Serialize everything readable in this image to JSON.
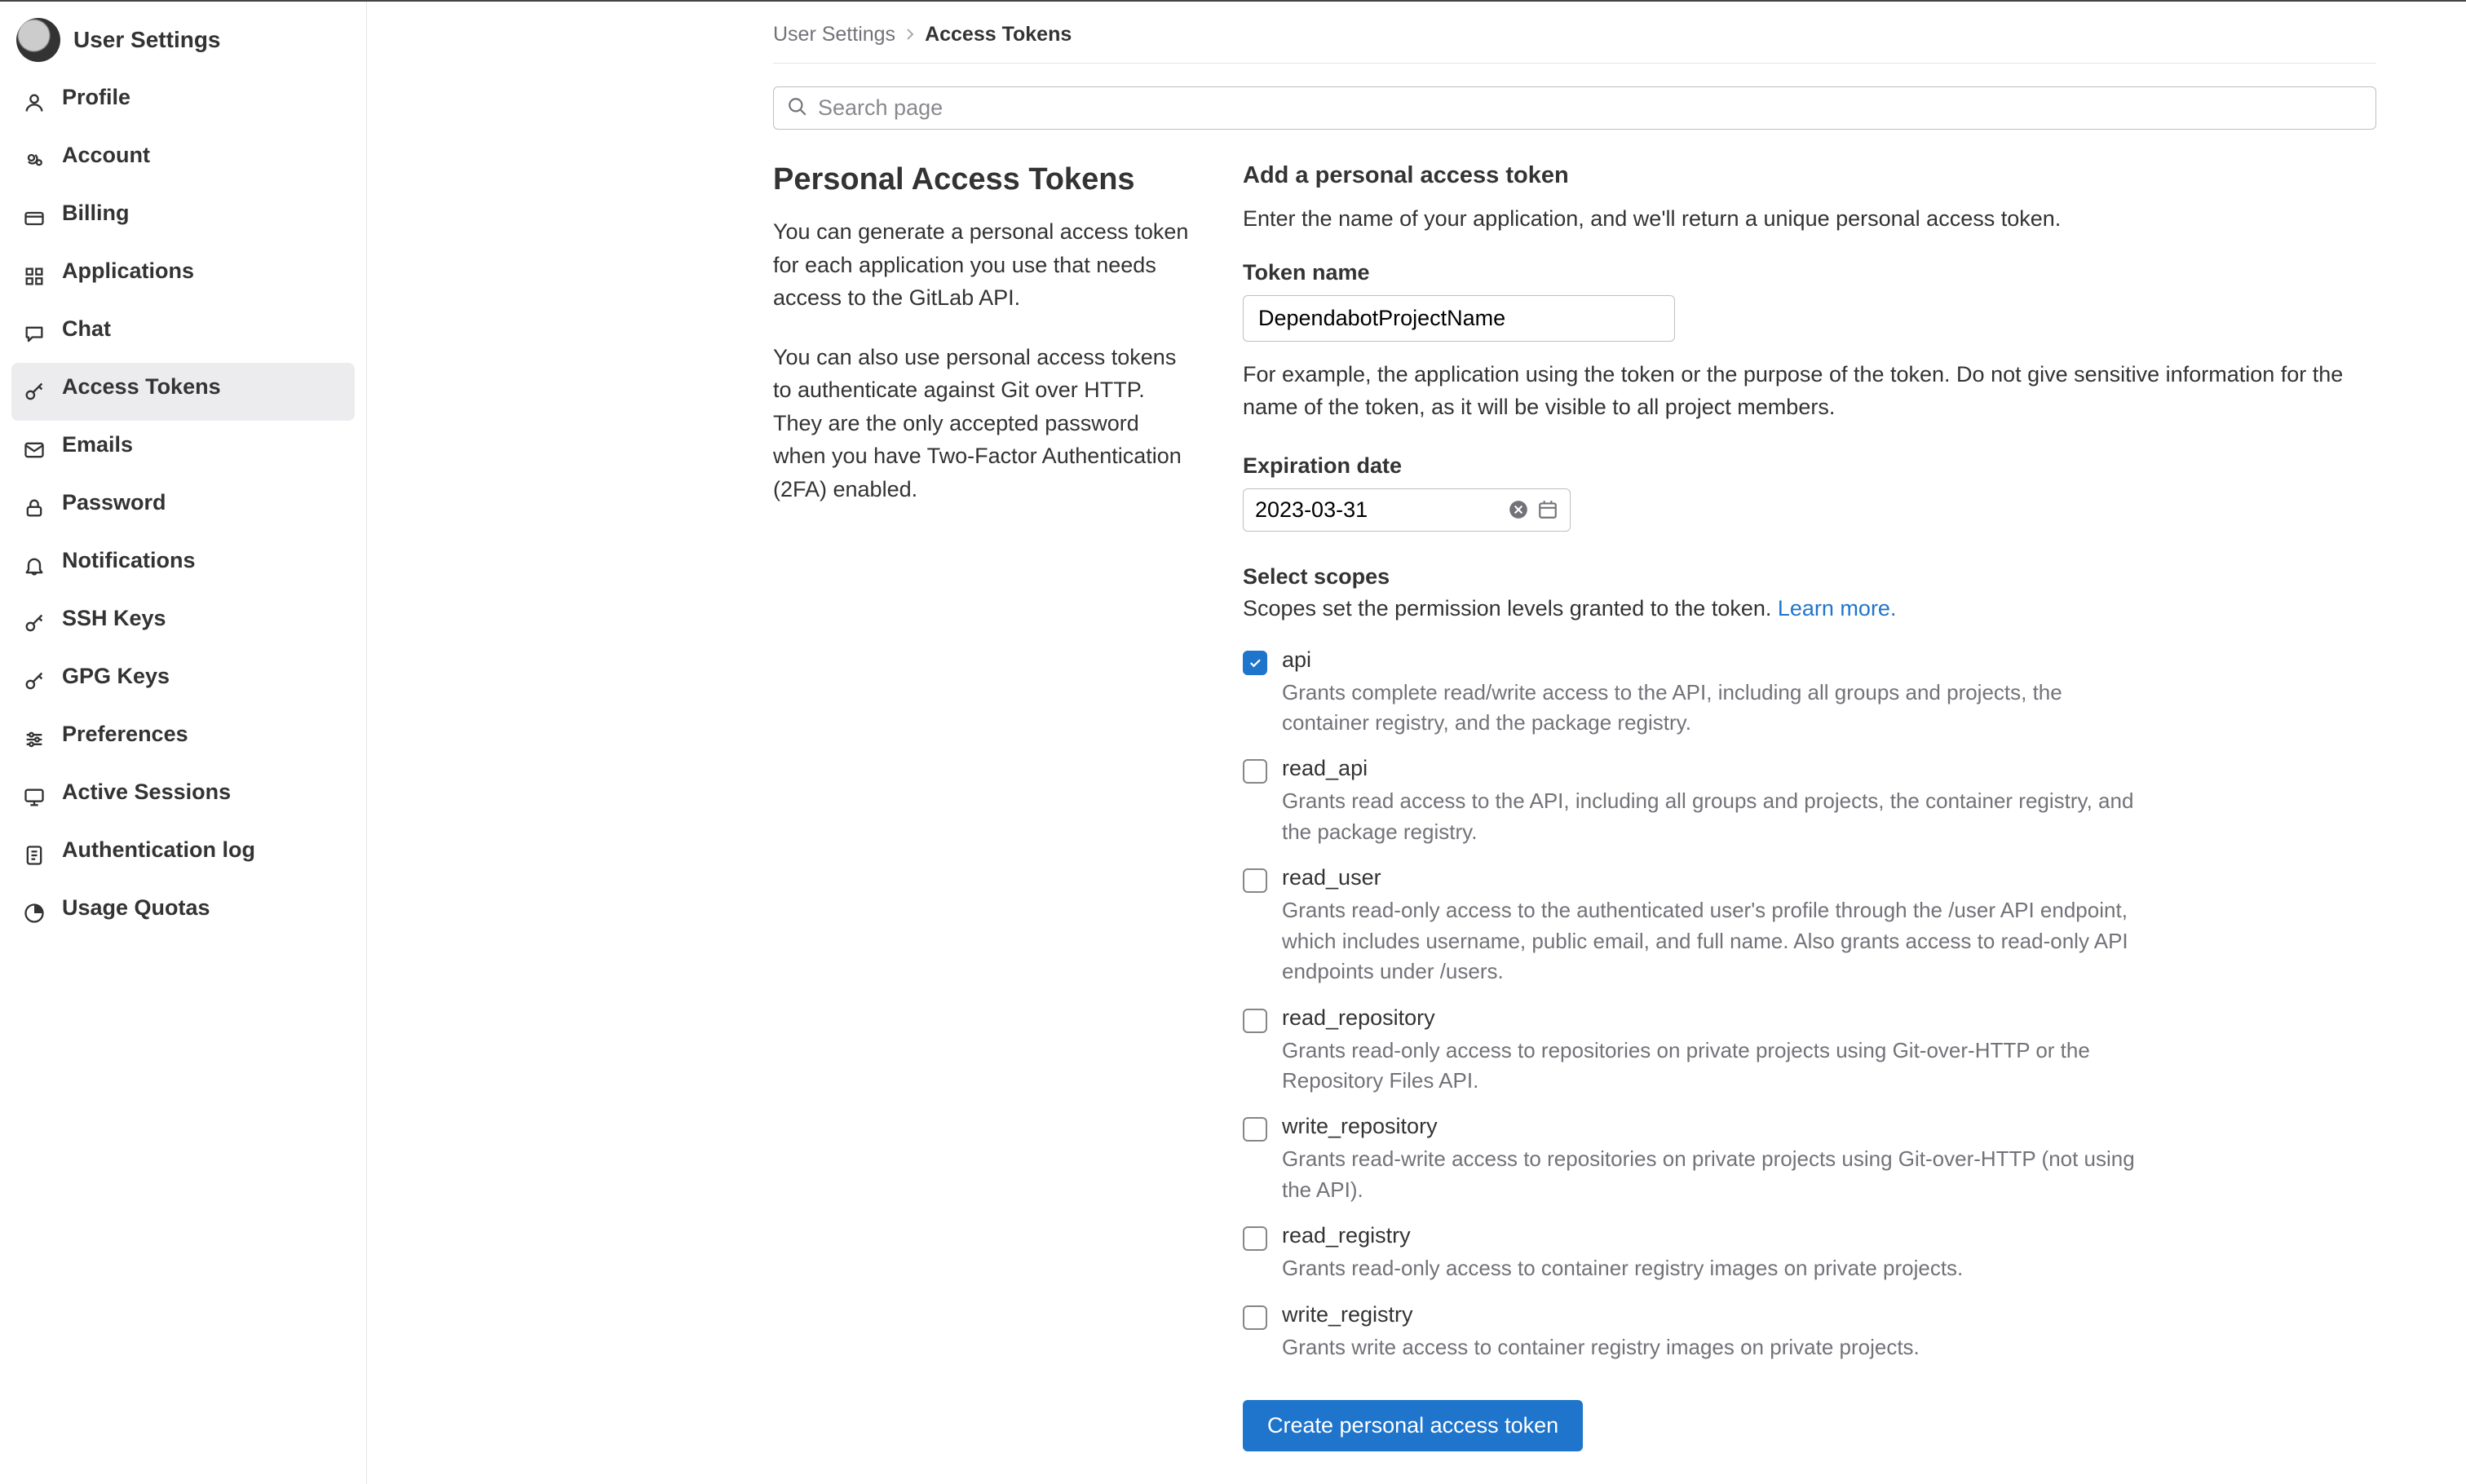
{
  "sidebar": {
    "title": "User Settings",
    "items": [
      {
        "icon": "user-icon",
        "label": "Profile"
      },
      {
        "icon": "account-icon",
        "label": "Account"
      },
      {
        "icon": "billing-icon",
        "label": "Billing"
      },
      {
        "icon": "applications-icon",
        "label": "Applications"
      },
      {
        "icon": "chat-icon",
        "label": "Chat"
      },
      {
        "icon": "key-icon",
        "label": "Access Tokens"
      },
      {
        "icon": "mail-icon",
        "label": "Emails"
      },
      {
        "icon": "lock-icon",
        "label": "Password"
      },
      {
        "icon": "bell-icon",
        "label": "Notifications"
      },
      {
        "icon": "key-icon",
        "label": "SSH Keys"
      },
      {
        "icon": "key-icon",
        "label": "GPG Keys"
      },
      {
        "icon": "preferences-icon",
        "label": "Preferences"
      },
      {
        "icon": "monitor-icon",
        "label": "Active Sessions"
      },
      {
        "icon": "log-icon",
        "label": "Authentication log"
      },
      {
        "icon": "quota-icon",
        "label": "Usage Quotas"
      }
    ],
    "active_index": 5
  },
  "breadcrumb": {
    "root": "User Settings",
    "current": "Access Tokens"
  },
  "search": {
    "placeholder": "Search page"
  },
  "left": {
    "title": "Personal Access Tokens",
    "p1": "You can generate a personal access token for each application you use that needs access to the GitLab API.",
    "p2": "You can also use personal access tokens to authenticate against Git over HTTP. They are the only accepted password when you have Two-Factor Authentication (2FA) enabled."
  },
  "form": {
    "heading": "Add a personal access token",
    "intro": "Enter the name of your application, and we'll return a unique personal access token.",
    "name_label": "Token name",
    "name_value": "DependabotProjectName",
    "name_help": "For example, the application using the token or the purpose of the token. Do not give sensitive information for the name of the token, as it will be visible to all project members.",
    "expiry_label": "Expiration date",
    "expiry_value": "2023-03-31",
    "scopes_heading": "Select scopes",
    "scopes_intro": "Scopes set the permission levels granted to the token. ",
    "learn_more": "Learn more.",
    "submit": "Create personal access token"
  },
  "scopes": [
    {
      "name": "api",
      "checked": true,
      "desc": "Grants complete read/write access to the API, including all groups and projects, the container registry, and the package registry."
    },
    {
      "name": "read_api",
      "checked": false,
      "desc": "Grants read access to the API, including all groups and projects, the container registry, and the package registry."
    },
    {
      "name": "read_user",
      "checked": false,
      "desc": "Grants read-only access to the authenticated user's profile through the /user API endpoint, which includes username, public email, and full name. Also grants access to read-only API endpoints under /users."
    },
    {
      "name": "read_repository",
      "checked": false,
      "desc": "Grants read-only access to repositories on private projects using Git-over-HTTP or the Repository Files API."
    },
    {
      "name": "write_repository",
      "checked": false,
      "desc": "Grants read-write access to repositories on private projects using Git-over-HTTP (not using the API)."
    },
    {
      "name": "read_registry",
      "checked": false,
      "desc": "Grants read-only access to container registry images on private projects."
    },
    {
      "name": "write_registry",
      "checked": false,
      "desc": "Grants write access to container registry images on private projects."
    }
  ]
}
